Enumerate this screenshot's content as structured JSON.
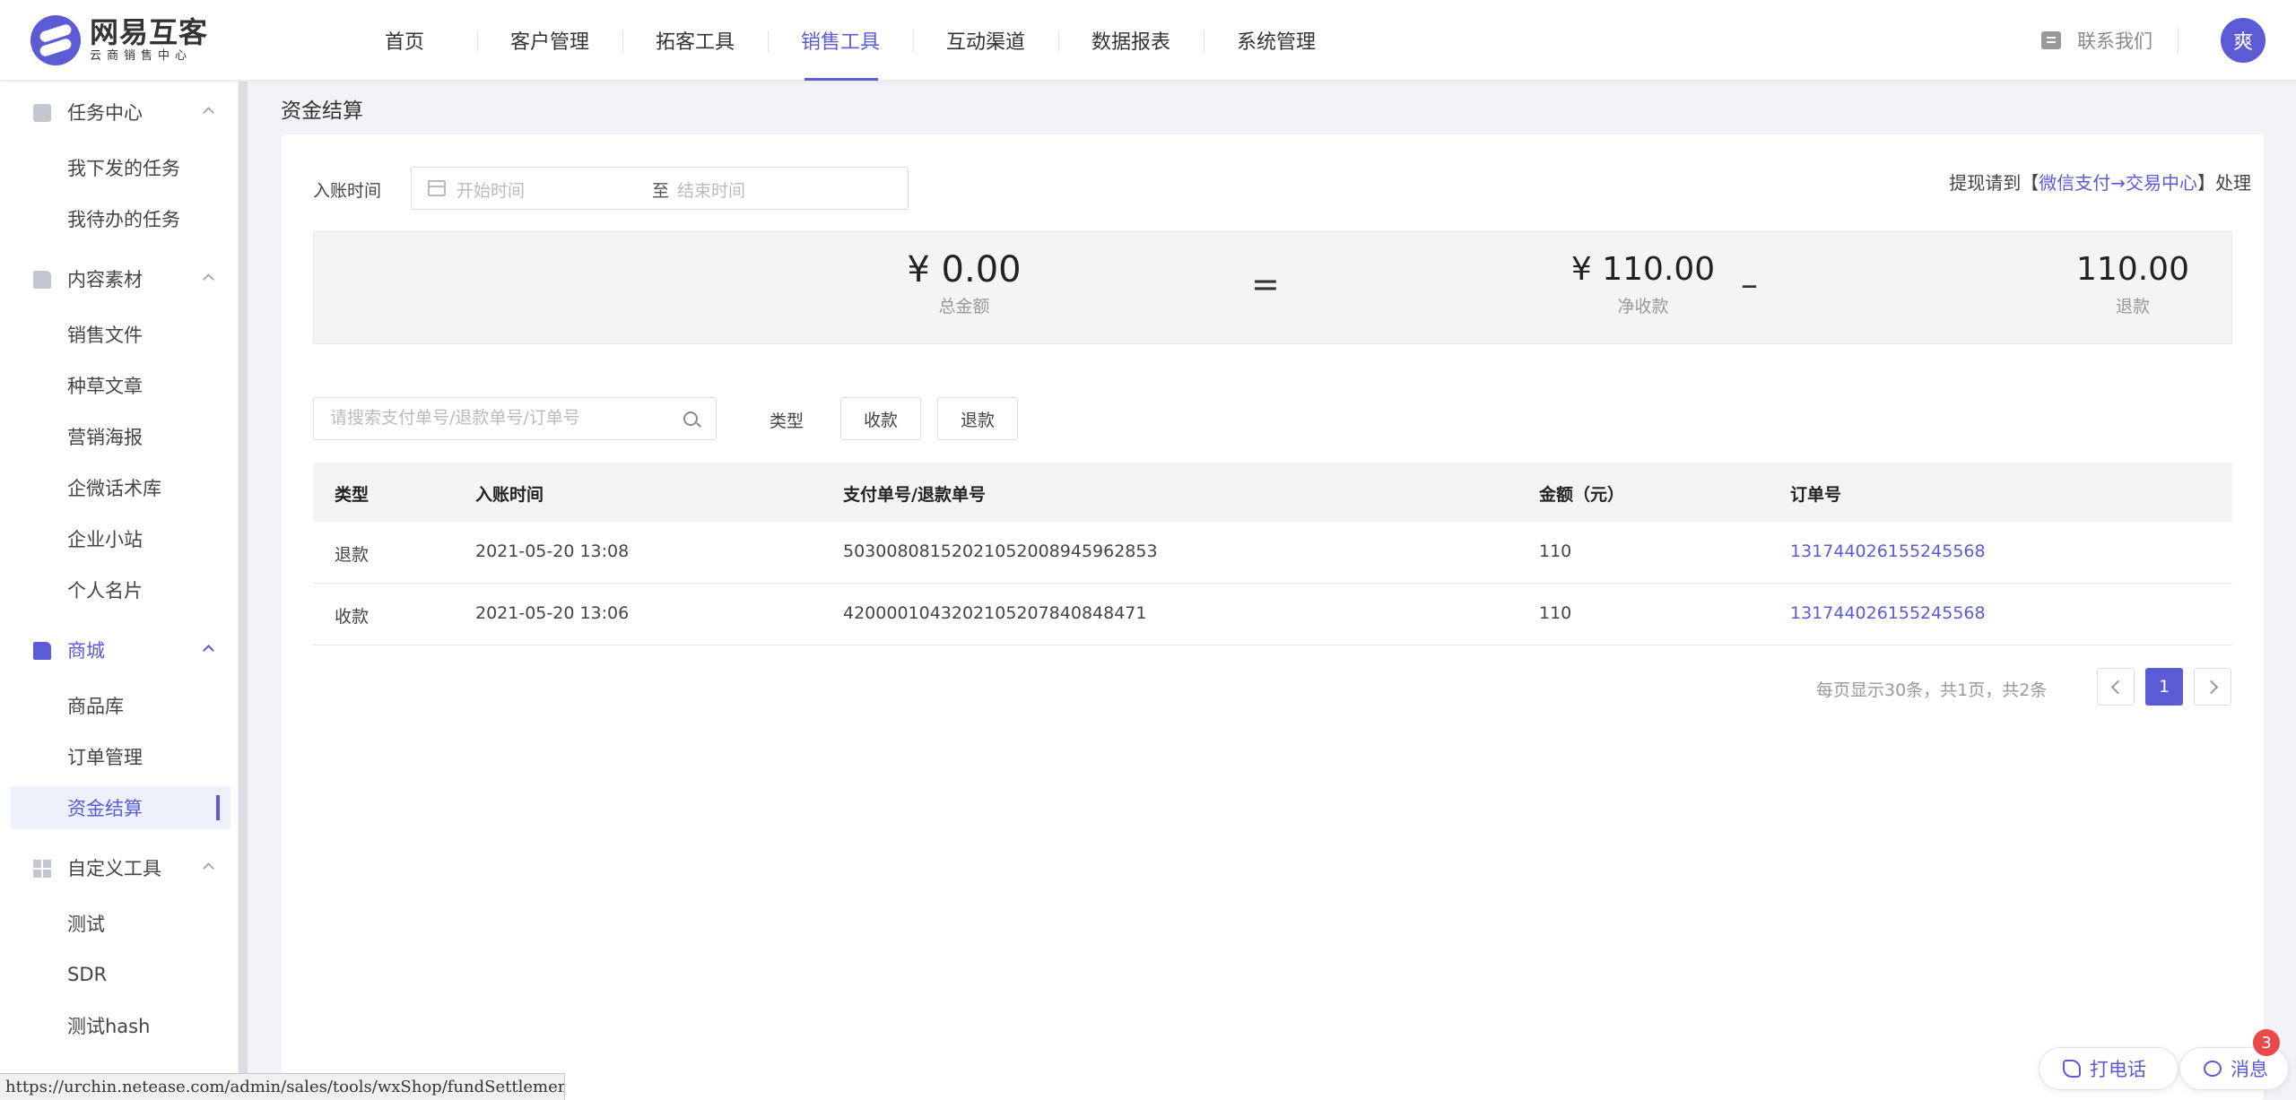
{
  "brand": {
    "name": "网易互客",
    "subtitle": "云商销售中心"
  },
  "nav": [
    {
      "label": "首页"
    },
    {
      "label": "客户管理"
    },
    {
      "label": "拓客工具"
    },
    {
      "label": "销售工具",
      "active": true
    },
    {
      "label": "互动渠道"
    },
    {
      "label": "数据报表"
    },
    {
      "label": "系统管理"
    }
  ],
  "header": {
    "contact_label": "联系我们",
    "avatar_text": "爽"
  },
  "sidebar": {
    "groups": [
      {
        "label": "任务中心",
        "icon": "calendar-icon",
        "items": [
          "我下发的任务",
          "我待办的任务"
        ]
      },
      {
        "label": "内容素材",
        "icon": "document-icon",
        "items": [
          "销售文件",
          "种草文章",
          "营销海报",
          "企微话术库",
          "企业小站",
          "个人名片"
        ]
      },
      {
        "label": "商城",
        "icon": "document-icon",
        "active": true,
        "items": [
          "商品库",
          "订单管理",
          "资金结算"
        ],
        "active_item": "资金结算"
      },
      {
        "label": "自定义工具",
        "icon": "grid-icon",
        "items": [
          "测试",
          "SDR",
          "测试hash"
        ]
      }
    ]
  },
  "page": {
    "title": "资金结算"
  },
  "filter": {
    "label": "入账时间",
    "start_placeholder": "开始时间",
    "separator": "至",
    "end_placeholder": "结束时间"
  },
  "withdraw": {
    "prefix": "提现请到【",
    "link": "微信支付→交易中心",
    "suffix": "】处理"
  },
  "summary": {
    "total_value": "¥ 0.00",
    "total_label": "总金额",
    "equals": "=",
    "net_value": "¥ 110.00",
    "net_label": "净收款",
    "minus": "–",
    "refund_value": "110.00",
    "refund_label": "退款"
  },
  "search": {
    "placeholder": "请搜索支付单号/退款单号/订单号"
  },
  "type_filter": {
    "label": "类型",
    "options": [
      "收款",
      "退款"
    ]
  },
  "table": {
    "headers": [
      "类型",
      "入账时间",
      "支付单号/退款单号",
      "金额（元）",
      "订单号"
    ],
    "rows": [
      [
        "退款",
        "2021-05-20 13:08",
        "50300808152021052008945962853",
        "110",
        "131744026155245568"
      ],
      [
        "收款",
        "2021-05-20 13:06",
        "4200001043202105207840848471",
        "110",
        "131744026155245568"
      ]
    ]
  },
  "pagination": {
    "summary": "每页显示30条，共1页，共2条",
    "current_page": "1"
  },
  "status_url": "https://urchin.netease.com/admin/sales/tools/wxShop/fundSettlement",
  "float": {
    "call_label": "打电话",
    "message_label": "消息",
    "message_badge": "3"
  },
  "colors": {
    "accent": "#5b5bd6",
    "badge": "#e84a4a",
    "background": "#f2f3f7"
  }
}
